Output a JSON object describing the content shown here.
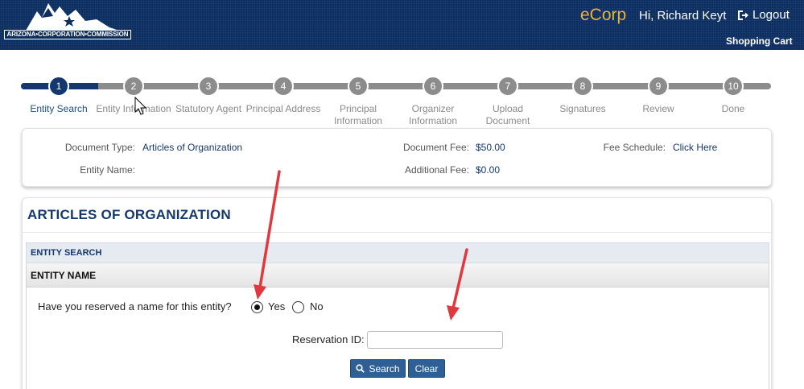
{
  "header": {
    "logo_text": "ARIZONA•CORPORATION•COMMISSION",
    "brand": "eCorp",
    "greeting": "Hi, Richard Keyt",
    "logout_label": "Logout",
    "cart_label": "Shopping Cart",
    "brand_color": "#e8b431",
    "bg_color": "#0d2d5c"
  },
  "stepper": {
    "active_step": 1,
    "steps": [
      {
        "num": "1",
        "label": "Entity Search"
      },
      {
        "num": "2",
        "label": "Entity Information"
      },
      {
        "num": "3",
        "label": "Statutory Agent"
      },
      {
        "num": "4",
        "label": "Principal Address"
      },
      {
        "num": "5",
        "label": "Principal Information"
      },
      {
        "num": "6",
        "label": "Organizer Information"
      },
      {
        "num": "7",
        "label": "Upload Document"
      },
      {
        "num": "8",
        "label": "Signatures"
      },
      {
        "num": "9",
        "label": "Review"
      },
      {
        "num": "10",
        "label": "Done"
      }
    ]
  },
  "info": {
    "document_type_label": "Document Type:",
    "document_type_value": "Articles of Organization",
    "entity_name_label": "Entity Name:",
    "entity_name_value": "",
    "document_fee_label": "Document Fee:",
    "document_fee_value": "$50.00",
    "additional_fee_label": "Additional Fee:",
    "additional_fee_value": "$0.00",
    "fee_schedule_label": "Fee Schedule:",
    "fee_schedule_link": "Click Here"
  },
  "form": {
    "title": "ARTICLES OF ORGANIZATION",
    "section": "ENTITY SEARCH",
    "subsection": "ENTITY NAME",
    "question": "Have you reserved a name for this entity?",
    "option_yes": "Yes",
    "option_no": "No",
    "selected": "Yes",
    "reservation_label": "Reservation ID:",
    "reservation_value": "",
    "search_button": "Search",
    "clear_button": "Clear"
  },
  "annotation_color": "#e0383e"
}
